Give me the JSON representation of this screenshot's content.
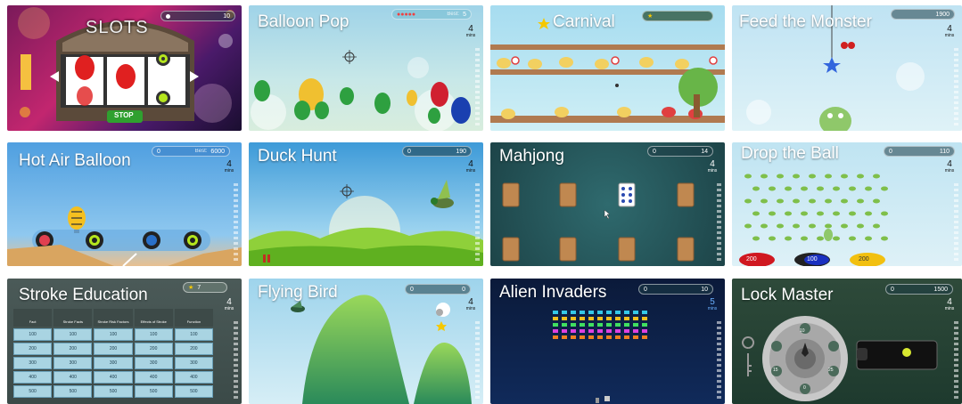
{
  "tiles": [
    {
      "id": "slots",
      "title": "SLOTS",
      "hud": {
        "label": "",
        "value": "10"
      },
      "stop_label": "STOP"
    },
    {
      "id": "balloon-pop",
      "title": "Balloon Pop",
      "hud": {
        "label": "Best:",
        "value": "5"
      },
      "mins": {
        "n": "4",
        "u": "mins"
      }
    },
    {
      "id": "carnival",
      "title": "Carnival",
      "hud": {
        "label": "",
        "value": ""
      }
    },
    {
      "id": "feed-the-monster",
      "title": "Feed the Monster",
      "hud": {
        "label": "",
        "value": "1900"
      },
      "mins": {
        "n": "4",
        "u": "mins"
      }
    },
    {
      "id": "hot-air-balloon",
      "title": "Hot Air Balloon",
      "hud": {
        "left": "0",
        "label": "Best:",
        "value": "6000"
      },
      "mins": {
        "n": "4",
        "u": "mins"
      }
    },
    {
      "id": "duck-hunt",
      "title": "Duck Hunt",
      "hud": {
        "left": "0",
        "label": "",
        "value": "190"
      },
      "mins": {
        "n": "4",
        "u": "mins"
      }
    },
    {
      "id": "mahjong",
      "title": "Mahjong",
      "hud": {
        "left": "0",
        "label": "",
        "value": "14"
      },
      "mins": {
        "n": "4",
        "u": "mins"
      }
    },
    {
      "id": "drop-the-ball",
      "title": "Drop the Ball",
      "hud": {
        "left": "0",
        "label": "",
        "value": "110"
      },
      "mins": {
        "n": "4",
        "u": "mins"
      },
      "bins": [
        "200",
        "100",
        "200"
      ]
    },
    {
      "id": "stroke-education",
      "title": "Stroke Education",
      "hud": {
        "label": "",
        "value": "7"
      },
      "mins": {
        "n": "4",
        "u": "mins"
      },
      "table": {
        "headers": [
          "Fact",
          "Stroke Facts",
          "Stroke Risk Factors",
          "Effects of Stroke",
          "Function"
        ],
        "rows": [
          [
            "100",
            "100",
            "100",
            "100",
            "100"
          ],
          [
            "200",
            "200",
            "200",
            "200",
            "200"
          ],
          [
            "300",
            "300",
            "300",
            "300",
            "300"
          ],
          [
            "400",
            "400",
            "400",
            "400",
            "400"
          ],
          [
            "500",
            "500",
            "500",
            "500",
            "500"
          ]
        ]
      }
    },
    {
      "id": "flying-bird",
      "title": "Flying Bird",
      "hud": {
        "left": "0",
        "label": "",
        "value": "0"
      },
      "mins": {
        "n": "4",
        "u": "mins"
      }
    },
    {
      "id": "alien-invaders",
      "title": "Alien Invaders",
      "hud": {
        "left": "0",
        "label": "",
        "value": "10"
      },
      "mins": {
        "n": "5",
        "u": "mins"
      }
    },
    {
      "id": "lock-master",
      "title": "Lock Master",
      "hud": {
        "left": "0",
        "label": "",
        "value": "1500"
      },
      "mins": {
        "n": "4",
        "u": "mins"
      },
      "dial_labels": [
        "10",
        "25",
        "0",
        "15"
      ]
    }
  ]
}
